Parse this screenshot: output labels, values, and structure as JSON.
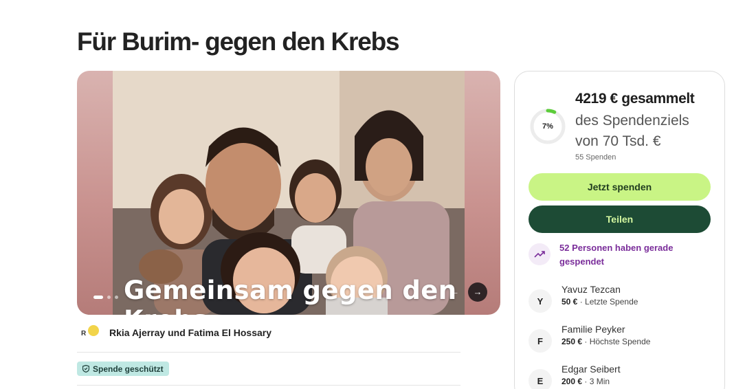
{
  "page": {
    "title": "Für Burim- gegen den Krebs"
  },
  "hero": {
    "caption": "Gemeinsam gegen den Krebs",
    "prev_icon": "arrow-left-icon",
    "next_icon": "arrow-right-icon",
    "slide_count": 3,
    "active_slide": 1
  },
  "organizer": {
    "initial": "R",
    "name": "Rkia Ajerray und Fatima El Hossary"
  },
  "badge": {
    "label": "Spende geschützt",
    "icon": "shield-icon"
  },
  "fundraiser": {
    "raised_text": "4219 € gesammelt",
    "goal_line1": "des Spendenziels",
    "goal_line2": "von 70 Tsd. €",
    "donation_count": "55 Spenden",
    "progress_percent": 7,
    "progress_label": "7%",
    "donate_label": "Jetzt spenden",
    "share_label": "Teilen",
    "trend_text": "52 Personen haben gerade gespendet",
    "trend_icon": "trending-up-icon",
    "colors": {
      "accent": "#c9f485",
      "dark": "#1d4b35",
      "trend": "#7a2d9a",
      "progress": "#5ccc3a"
    }
  },
  "donors": [
    {
      "initial": "Y",
      "name": "Yavuz Tezcan",
      "amount": "50 €",
      "note": "Letzte Spende"
    },
    {
      "initial": "F",
      "name": "Familie Peyker",
      "amount": "250 €",
      "note": "Höchste Spende"
    },
    {
      "initial": "E",
      "name": "Edgar Seibert",
      "amount": "200 €",
      "note": "3 Min"
    }
  ]
}
